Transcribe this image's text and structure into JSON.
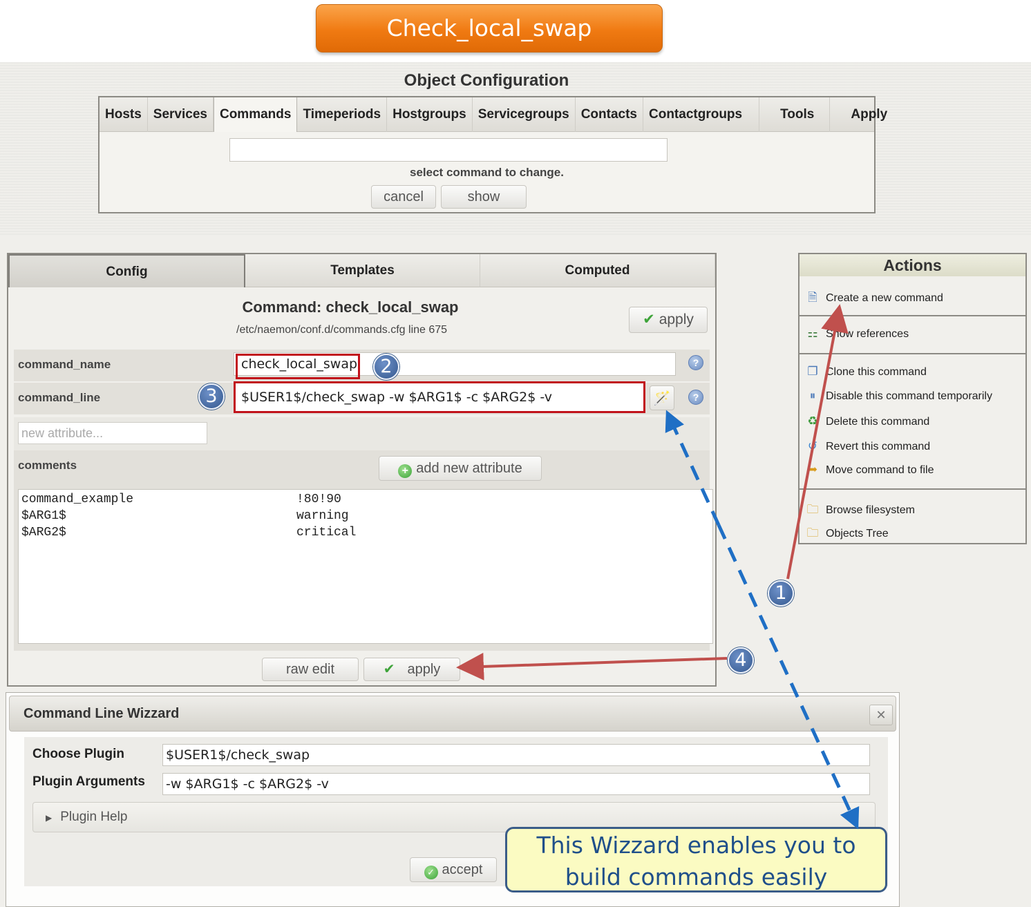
{
  "banner": {
    "title": "Check_local_swap"
  },
  "header": {
    "title": "Object Configuration"
  },
  "nav": {
    "tabs": [
      "Hosts",
      "Services",
      "Commands",
      "Timeperiods",
      "Hostgroups",
      "Servicegroups",
      "Contacts",
      "Contactgroups",
      "Tools",
      "Apply"
    ],
    "active": "Commands",
    "select_hint": "select command to change.",
    "cancel_label": "cancel",
    "show_label": "show"
  },
  "config": {
    "tabs": {
      "config": "Config",
      "templates": "Templates",
      "computed": "Computed"
    },
    "title": "Command: check_local_swap",
    "path": "/etc/naemon/conf.d/commands.cfg line 675",
    "apply_label": "apply",
    "command_name_label": "command_name",
    "command_name_value": "check_local_swap",
    "command_line_label": "command_line",
    "command_line_value": "$USER1$/check_swap -w $ARG1$ -c $ARG2$ -v",
    "new_attribute_placeholder": "new attribute...",
    "comments_label": "comments",
    "add_attribute_label": "add new attribute",
    "comments": [
      {
        "key": "command_example",
        "value": "!80!90"
      },
      {
        "key": "$ARG1$",
        "value": "warning"
      },
      {
        "key": "$ARG2$",
        "value": "critical"
      }
    ],
    "raw_edit_label": "raw edit",
    "apply_bottom_label": "apply"
  },
  "actions": {
    "title": "Actions",
    "items": [
      {
        "label": "Create a new command",
        "icon": "new-document-icon"
      },
      {
        "label": "Show references",
        "icon": "sitemap-icon"
      },
      {
        "label": "Clone this command",
        "icon": "copy-icon"
      },
      {
        "label": "Disable this command temporarily",
        "icon": "pause-icon"
      },
      {
        "label": "Delete this command",
        "icon": "recycle-icon"
      },
      {
        "label": "Revert this command",
        "icon": "revert-icon"
      },
      {
        "label": "Move command to file",
        "icon": "move-icon"
      },
      {
        "label": "Browse filesystem",
        "icon": "folder-search-icon"
      },
      {
        "label": "Objects Tree",
        "icon": "folder-icon"
      }
    ]
  },
  "wizard": {
    "title": "Command Line Wizzard",
    "close_icon": "close-icon",
    "choose_plugin_label": "Choose Plugin",
    "choose_plugin_value": "$USER1$/check_swap",
    "plugin_arguments_label": "Plugin Arguments",
    "plugin_arguments_value": "-w $ARG1$ -c $ARG2$ -v",
    "plugin_help_label": "Plugin Help",
    "accept_label": "accept"
  },
  "annotations": {
    "steps": [
      "1",
      "2",
      "3",
      "4"
    ],
    "callout": "This Wizzard enables you to build commands easily",
    "arrow_color": "#c0504d",
    "dashed_color": "#1f6fc5"
  }
}
